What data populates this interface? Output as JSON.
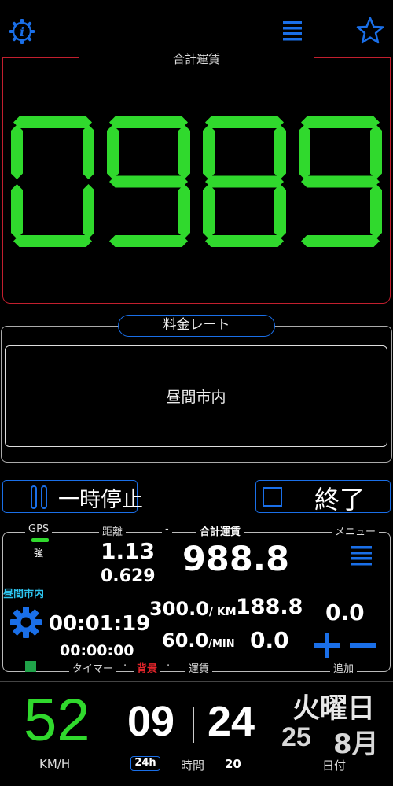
{
  "colors": {
    "accent": "#1a6fe8",
    "fare_digits": "#30d92d",
    "fare_border": "#c21f2e",
    "background_label": "#e3252b",
    "rate_name": "#2dc5f0"
  },
  "icons": {
    "info": "info-gear-icon",
    "menu": "hamburger-icon",
    "star": "star-icon",
    "pause": "pause-icon",
    "stop": "stop-square-icon",
    "settings": "gear-icon",
    "plus": "plus-icon",
    "minus": "minus-icon"
  },
  "fare": {
    "title": "合計運賃",
    "digits": "0989"
  },
  "rate": {
    "title": "料金レート",
    "name": "昼間市内"
  },
  "buttons": {
    "pause_label": "一時停止",
    "stop_label": "終了"
  },
  "info": {
    "gps_label": "GPS",
    "gps_strength": "強",
    "distance_label": "距離",
    "dash": "-",
    "total_label": "合計運賃",
    "menu_label": "メニュー",
    "distance_km": "1.13",
    "distance_sub": "0.629",
    "total_value": "988.8",
    "rate_name": "昼間市内",
    "timer": "00:01:19",
    "timer_sub": "00:00:00",
    "rate_per_km": "300.0",
    "rate_per_km_unit": "/ KM",
    "km_fare": "188.8",
    "rate_per_min": "60.0",
    "rate_per_min_unit": "/MIN",
    "min_fare": "0.0",
    "add_value": "0.0",
    "timer_label": "タイマー",
    "dot": "·",
    "background_label": "背景",
    "fare_label": "運賃",
    "add_label": "追加"
  },
  "bottom": {
    "speed": "52",
    "speed_unit": "KM/H",
    "hour": "09",
    "minute": "24",
    "h24": "24h",
    "time_label": "時間",
    "second": "20",
    "weekday": "火曜日",
    "day": "25",
    "month": "8月",
    "date_label": "日付"
  }
}
